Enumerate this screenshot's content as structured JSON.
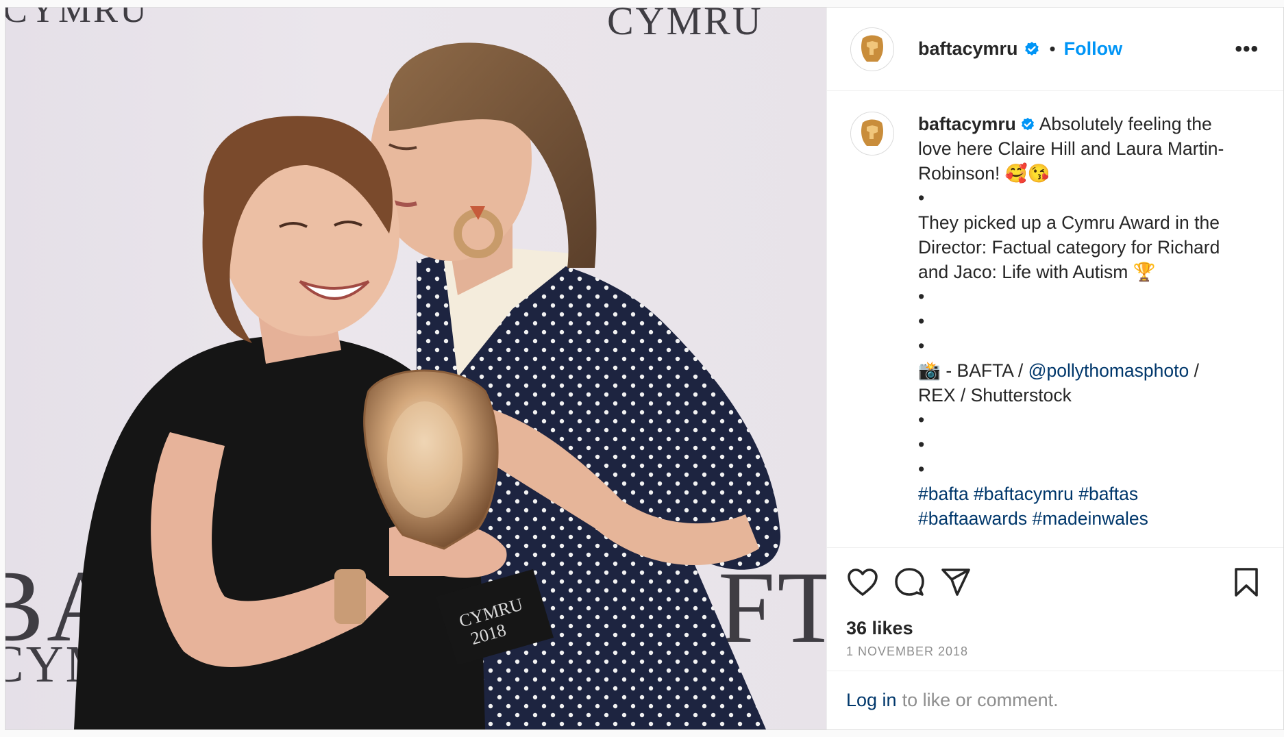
{
  "photo": {
    "watermark_top_left": "CYMRU",
    "watermark_top_right": "CYMRU",
    "watermark_bottom_left": "BA",
    "watermark_bottom_left_sub": "CYM",
    "watermark_bottom_right": "FT",
    "trophy_plaque_line1": "CYMRU",
    "trophy_plaque_line2": "2018"
  },
  "header": {
    "username": "baftacymru",
    "separator": "•",
    "follow_label": "Follow",
    "more_label": "•••"
  },
  "caption": {
    "username": "baftacymru",
    "line1": " Absolutely feeling the love here Claire Hill and Laura Martin-Robinson! 🥰😘",
    "dot1": "•",
    "line2": "They picked up a Cymru Award in the Director: Factual category for Richard and Jaco: Life with Autism 🏆",
    "dot2": "•",
    "dot3": "•",
    "dot4": "•",
    "credit_prefix": "📸 - BAFTA / ",
    "credit_mention": "@pollythomasphoto",
    "credit_suffix": " / REX / Shutterstock",
    "dot5": "•",
    "dot6": "•",
    "dot7": "•",
    "hashtags": "#bafta #baftacymru #baftas #baftaawards #madeinwales"
  },
  "stats": {
    "likes": "36 likes",
    "date": "1 NOVEMBER 2018"
  },
  "footer": {
    "login_label": "Log in",
    "login_suffix": " to like or comment."
  },
  "colors": {
    "accent": "#0095f6",
    "link": "#00376b",
    "verified": "#0095f6",
    "muted": "#8e8e8e"
  },
  "icons": [
    "verified-badge-icon",
    "heart-icon",
    "comment-icon",
    "share-icon",
    "bookmark-icon",
    "more-icon",
    "bafta-mask-icon"
  ]
}
